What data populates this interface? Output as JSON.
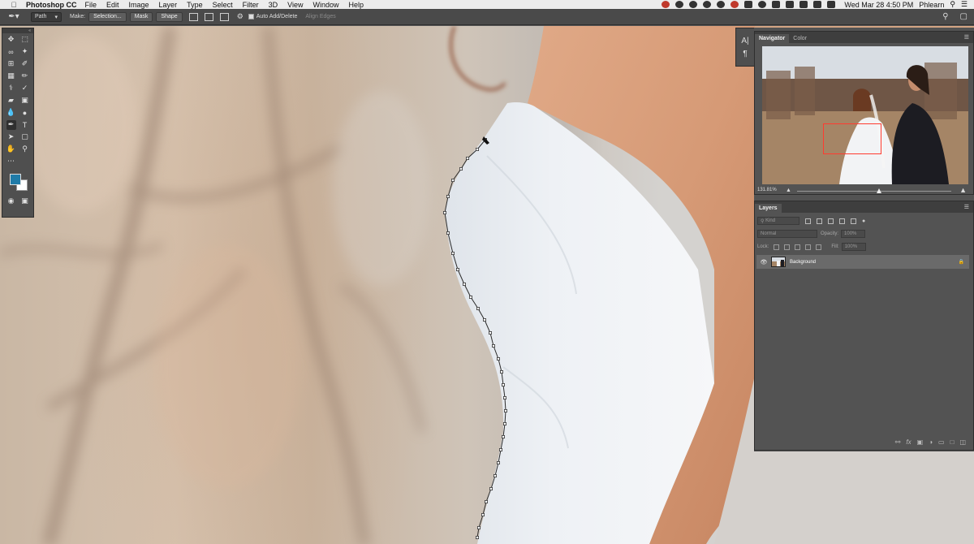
{
  "menubar": {
    "app_name": "Photoshop CC",
    "menus": [
      "File",
      "Edit",
      "Image",
      "Layer",
      "Type",
      "Select",
      "Filter",
      "3D",
      "View",
      "Window",
      "Help"
    ],
    "clock": "Wed Mar 28  4:50 PM",
    "user": "Phlearn"
  },
  "options_bar": {
    "mode": "Path",
    "make_label": "Make:",
    "selection_button": "Selection...",
    "mask_button": "Mask",
    "shape_button": "Shape",
    "auto_add_delete": "Auto Add/Delete",
    "align_edges": "Align Edges"
  },
  "side_strip": {
    "char_label": "A|",
    "para_label": "¶"
  },
  "navigator": {
    "tabs": [
      "Navigator",
      "Color"
    ],
    "zoom": "131.81%"
  },
  "layers": {
    "tab": "Layers",
    "filter_kind": "Kind",
    "blend_mode": "Normal",
    "opacity_label": "Opacity:",
    "opacity_value": "100%",
    "lock_label": "Lock:",
    "fill_label": "Fill:",
    "fill_value": "100%",
    "items": [
      {
        "name": "Background"
      }
    ],
    "footer_icons": [
      "link-icon",
      "fx-icon",
      "mask-icon",
      "adjustment-icon",
      "folder-icon",
      "new-layer-icon",
      "trash-icon"
    ]
  },
  "colors": {
    "foreground": "#1f7ba8",
    "background": "#ffffff",
    "nav_view_box": "#ff3b30"
  }
}
